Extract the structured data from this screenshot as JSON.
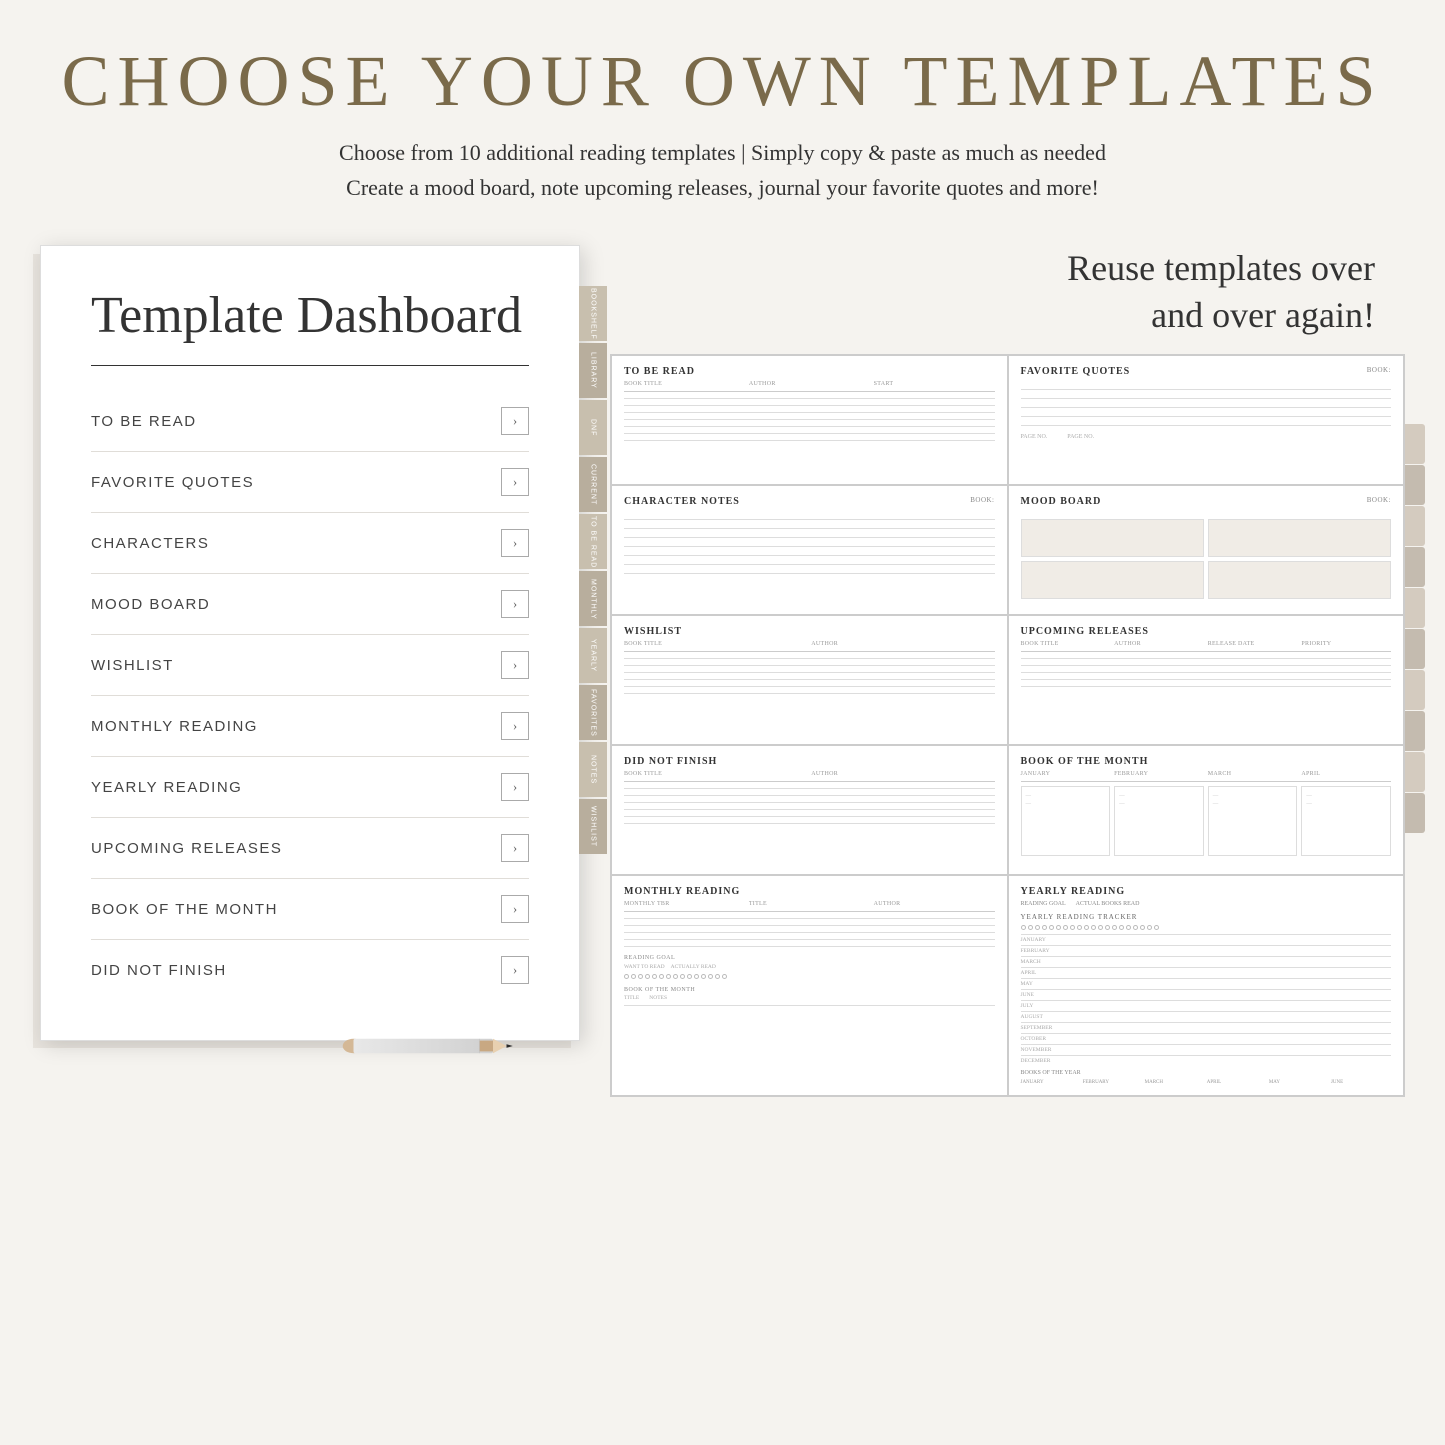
{
  "header": {
    "title": "CHOOSE YOUR OWN TEMPLATES",
    "subtitle_line1": "Choose from 10 additional reading templates | Simply copy & paste as much as needed",
    "subtitle_line2": "Create a mood board, note upcoming releases, journal your favorite quotes and more!"
  },
  "reuse_text_line1": "Reuse templates over",
  "reuse_text_line2": "and over again!",
  "dashboard": {
    "title": "Template Dashboard",
    "items": [
      {
        "label": "TO BE READ"
      },
      {
        "label": "FAVORITE QUOTES"
      },
      {
        "label": "CHARACTERS"
      },
      {
        "label": "MOOD BOARD"
      },
      {
        "label": "WISHLIST"
      },
      {
        "label": "MONTHLY READING"
      },
      {
        "label": "YEARLY READING"
      },
      {
        "label": "UPCOMING RELEASES"
      },
      {
        "label": "BOOK OF THE MONTH"
      },
      {
        "label": "DID NOT FINISH"
      }
    ]
  },
  "side_tabs": [
    "BOOKSHELF",
    "LIBRARY",
    "DNF",
    "CURRENT",
    "TO BE READ",
    "MONTHLY",
    "YEARLY",
    "FAVORITES",
    "NOTES",
    "WISHLIST"
  ],
  "templates": [
    {
      "title": "TO BE READ",
      "subtitle": "BOOK TITLE / AUTHOR / START",
      "type": "table"
    },
    {
      "title": "FAVORITE QUOTES",
      "subtitle": "BOOK",
      "type": "lines"
    },
    {
      "title": "CHARACTER NOTES",
      "subtitle": "BOOK",
      "type": "lines"
    },
    {
      "title": "MOOD BOARD",
      "subtitle": "BOOK",
      "type": "mood"
    },
    {
      "title": "WISHLIST",
      "subtitle": "BOOK TITLE / AUTHOR",
      "type": "table"
    },
    {
      "title": "UPCOMING RELEASES",
      "subtitle": "BOOK TITLE / AUTHOR / RELEASE DATE / PRIORITY",
      "type": "table"
    },
    {
      "title": "DID NOT FINISH",
      "subtitle": "BOOK TITLE / AUTHOR",
      "type": "table"
    },
    {
      "title": "BOOK OF THE MONTH",
      "subtitle": "JANUARY / FEBRUARY / MARCH / APRIL",
      "type": "months"
    },
    {
      "title": "MONTHLY READING",
      "subtitle": "MONTHLY TBR / TITLE / AUTHOR",
      "type": "monthly"
    },
    {
      "title": "YEARLY READING",
      "subtitle": "READING GOAL / ACTUAL BOOKS READ",
      "type": "yearly"
    }
  ]
}
